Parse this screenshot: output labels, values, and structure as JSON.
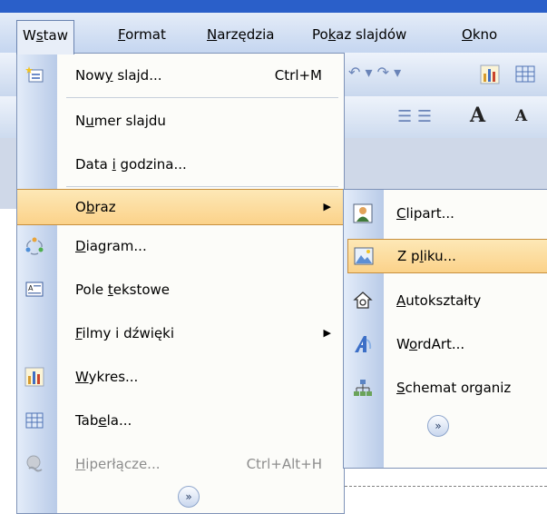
{
  "menubar": {
    "items": [
      {
        "pre": "W",
        "u": "s",
        "post": "taw"
      },
      {
        "pre": "",
        "u": "F",
        "post": "ormat"
      },
      {
        "pre": "",
        "u": "N",
        "post": "arzędzia"
      },
      {
        "pre": "Po",
        "u": "k",
        "post": "az slajdów"
      },
      {
        "pre": "",
        "u": "O",
        "post": "kno"
      }
    ]
  },
  "menu": {
    "items": [
      {
        "pre": "Now",
        "u": "y",
        "post": " slajd...",
        "shortcut": "Ctrl+M",
        "icon": "new-slide-icon"
      },
      {
        "pre": "N",
        "u": "u",
        "post": "mer slajdu"
      },
      {
        "pre": "Data ",
        "u": "i",
        "post": " godzina..."
      },
      {
        "pre": "O",
        "u": "b",
        "post": "raz",
        "submenu": true
      },
      {
        "pre": "",
        "u": "D",
        "post": "iagram...",
        "icon": "diagram-icon"
      },
      {
        "pre": "Pole ",
        "u": "t",
        "post": "ekstowe",
        "icon": "text-box-icon"
      },
      {
        "pre": "",
        "u": "F",
        "post": "ilmy i dźwięki",
        "submenu": true
      },
      {
        "pre": "",
        "u": "W",
        "post": "ykres...",
        "icon": "chart-icon"
      },
      {
        "pre": "Tab",
        "u": "e",
        "post": "la...",
        "icon": "table-icon"
      },
      {
        "pre": "",
        "u": "H",
        "post": "iperłącze...",
        "shortcut": "Ctrl+Alt+H",
        "icon": "hyperlink-icon"
      }
    ],
    "arrow": "▶",
    "expand": "»"
  },
  "submenu": {
    "items": [
      {
        "pre": "",
        "u": "C",
        "post": "lipart...",
        "icon": "clipart-icon"
      },
      {
        "pre": "Z p",
        "u": "l",
        "post": "iku...",
        "icon": "from-file-icon"
      },
      {
        "pre": "",
        "u": "A",
        "post": "utokształty",
        "icon": "autoshapes-icon"
      },
      {
        "pre": "W",
        "u": "o",
        "post": "rdArt...",
        "icon": "wordart-icon"
      },
      {
        "pre": "",
        "u": "S",
        "post": "chemat organiz",
        "icon": "org-chart-icon"
      }
    ],
    "expand": "»"
  },
  "toolbar": {
    "undo": "↶ ▾ ↷ ▾",
    "font_grow": "A",
    "font_shrink": "A",
    "list_glyphs": "☰ ☰"
  },
  "colors": {
    "highlight_top": "#fde8b6",
    "highlight_bottom": "#fbd28a",
    "gutter": "#c6d6ef",
    "menubar": "#d4e0f3"
  }
}
